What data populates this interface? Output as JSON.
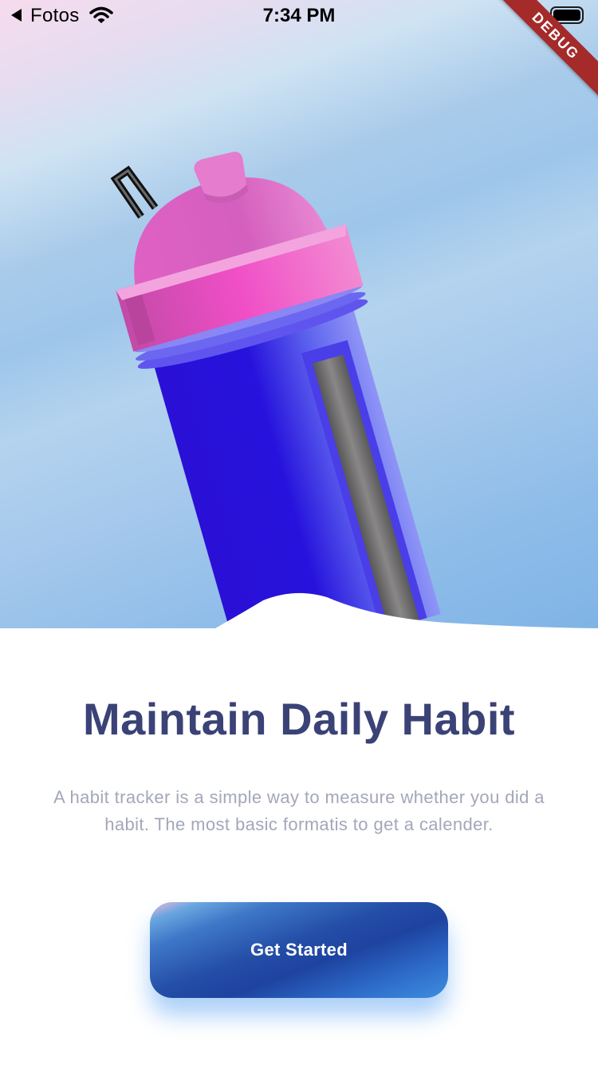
{
  "status_bar": {
    "back_label": "Fotos",
    "time": "7:34 PM",
    "debug_banner": "DEBUG"
  },
  "onboarding": {
    "title": "Maintain Daily Habit",
    "description": "A habit tracker is a simple way to measure whether you did a habit. The most basic formatis to get a calender.",
    "cta_label": "Get Started"
  },
  "icons": [
    "back-arrow-icon",
    "wifi-icon",
    "battery-icon",
    "shaker-bottle-illustration"
  ],
  "colors": {
    "title": "#3a4276",
    "description": "#a3a7b9",
    "button_dark": "#1e43a0",
    "bottle_body": "#2a12d8",
    "bottle_cap": "#e35fc3",
    "debug": "#a52a2a"
  }
}
